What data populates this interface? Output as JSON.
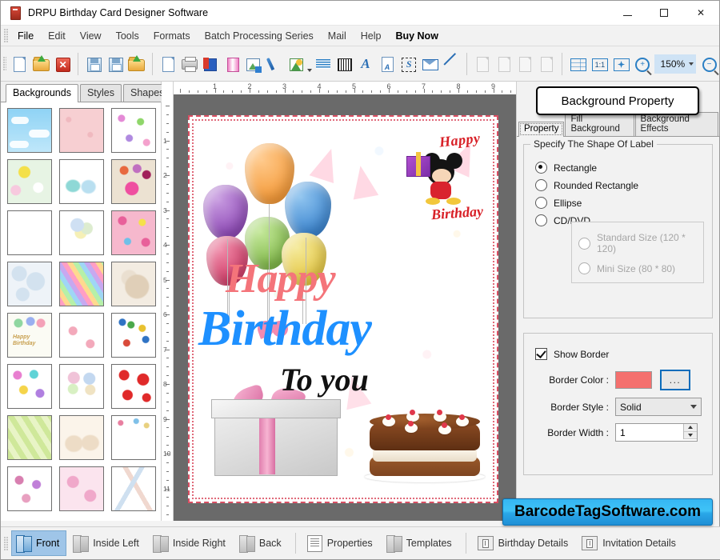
{
  "window": {
    "title": "DRPU Birthday Card Designer Software",
    "app_icon": "app-icon",
    "minimize": "—",
    "maximize": "□",
    "close": "✕"
  },
  "menubar": {
    "items": [
      {
        "label": "File",
        "emphasis": "strong"
      },
      {
        "label": "Edit",
        "emphasis": "normal"
      },
      {
        "label": "View",
        "emphasis": "normal"
      },
      {
        "label": "Tools",
        "emphasis": "normal"
      },
      {
        "label": "Formats",
        "emphasis": "normal"
      },
      {
        "label": "Batch Processing Series",
        "emphasis": "normal"
      },
      {
        "label": "Mail",
        "emphasis": "normal"
      },
      {
        "label": "Help",
        "emphasis": "normal"
      },
      {
        "label": "Buy Now",
        "emphasis": "bold"
      }
    ]
  },
  "toolbar": {
    "groups": [
      {
        "buttons": [
          {
            "icon": "new-document-icon",
            "title": "New"
          },
          {
            "icon": "open-folder-icon",
            "title": "Open"
          },
          {
            "icon": "close-document-icon",
            "title": "Close"
          }
        ]
      },
      {
        "buttons": [
          {
            "icon": "save-icon",
            "title": "Save"
          },
          {
            "icon": "save-as-icon",
            "title": "Save As"
          },
          {
            "icon": "export-folder-icon",
            "title": "Export"
          }
        ]
      },
      {
        "buttons": [
          {
            "icon": "page-setup-icon",
            "title": "Page Setup"
          },
          {
            "icon": "print-icon",
            "title": "Print"
          },
          {
            "icon": "card-stack-icon",
            "title": "Cards"
          },
          {
            "icon": "gift-icon",
            "title": "Gift"
          },
          {
            "icon": "add-image-icon",
            "title": "Add Image"
          },
          {
            "icon": "pen-icon",
            "title": "Pen"
          },
          {
            "icon": "picture-icon",
            "title": "Picture",
            "has_dropdown": true
          },
          {
            "icon": "watermark-icon",
            "title": "Watermark"
          },
          {
            "icon": "barcode-icon",
            "title": "Barcode"
          },
          {
            "icon": "text-italic-icon",
            "title": "Text"
          },
          {
            "icon": "text-page-icon",
            "title": "Text Page"
          },
          {
            "icon": "signature-icon",
            "title": "Signature"
          },
          {
            "icon": "envelope-icon",
            "title": "Envelope"
          },
          {
            "icon": "line-icon",
            "title": "Line"
          }
        ]
      },
      {
        "buttons": [
          {
            "icon": "cut-icon",
            "title": "Cut",
            "disabled": true
          },
          {
            "icon": "copy-icon",
            "title": "Copy",
            "disabled": true
          },
          {
            "icon": "paste-icon",
            "title": "Paste",
            "disabled": true
          },
          {
            "icon": "delete-icon",
            "title": "Delete",
            "disabled": true
          }
        ]
      },
      {
        "buttons": [
          {
            "icon": "grid-icon",
            "title": "Grid"
          },
          {
            "icon": "actual-size-icon",
            "title": "1:1"
          },
          {
            "icon": "fit-to-window-icon",
            "title": "Fit"
          },
          {
            "icon": "zoom-in-icon",
            "title": "Zoom In"
          }
        ]
      }
    ],
    "zoom_value": "150%",
    "zoom_out_icon": "zoom-out-icon",
    "one_to_one_label": "1:1"
  },
  "left_panel": {
    "tabs": [
      {
        "label": "Backgrounds",
        "active": true
      },
      {
        "label": "Styles",
        "active": false
      },
      {
        "label": "Shapes",
        "active": false
      }
    ],
    "thumbnails": [
      {
        "name": "clouds-sky"
      },
      {
        "name": "pink-texture"
      },
      {
        "name": "butterflies-flowers"
      },
      {
        "name": "yellow-daisies"
      },
      {
        "name": "pastel-winter-scene"
      },
      {
        "name": "beige-balloons"
      },
      {
        "name": "blue-stars"
      },
      {
        "name": "white-balloons"
      },
      {
        "name": "pink-cakes-balloons"
      },
      {
        "name": "white-bubbles"
      },
      {
        "name": "rainbow-gradient"
      },
      {
        "name": "cream-teddy"
      },
      {
        "name": "happy-birthday-balloons"
      },
      {
        "name": "pink-hearts-stripes"
      },
      {
        "name": "blue-sky-balloons"
      },
      {
        "name": "colorful-hearts"
      },
      {
        "name": "balloon-bouquets"
      },
      {
        "name": "red-hearts"
      },
      {
        "name": "green-stripes"
      },
      {
        "name": "cream-cakes"
      },
      {
        "name": "green-meadow-gifts"
      },
      {
        "name": "pink-lollipops"
      },
      {
        "name": "pink-swirl-hearts"
      },
      {
        "name": "party-hats"
      }
    ]
  },
  "rulers": {
    "horizontal_labels": [
      "1",
      "2",
      "3",
      "4",
      "5",
      "6",
      "7",
      "8",
      "9"
    ],
    "vertical_labels": [
      "1",
      "2",
      "3",
      "4",
      "5",
      "6",
      "7",
      "8",
      "9",
      "10",
      "11"
    ]
  },
  "card": {
    "line_happy": "Happy",
    "line_birthday": "Birthday",
    "line_to_you": "To you",
    "corner_happy": "Happy",
    "corner_birthday": "Birthday",
    "border_color": "#d94f63"
  },
  "right_panel": {
    "badge_title": "Background Property",
    "tabs": [
      {
        "label": "Property",
        "active": true
      },
      {
        "label": "Fill Background",
        "active": false
      },
      {
        "label": "Background Effects",
        "active": false
      }
    ],
    "shape_group": {
      "legend": "Specify The Shape Of Label",
      "options": [
        {
          "label": "Rectangle",
          "selected": true,
          "disabled": false
        },
        {
          "label": "Rounded Rectangle",
          "selected": false,
          "disabled": false
        },
        {
          "label": "Ellipse",
          "selected": false,
          "disabled": false
        },
        {
          "label": "CD/DVD",
          "selected": false,
          "disabled": false
        }
      ],
      "cd_sizes": [
        {
          "label": "Standard Size (120 * 120)",
          "selected": false,
          "disabled": true
        },
        {
          "label": "Mini Size (80 * 80)",
          "selected": false,
          "disabled": true
        }
      ]
    },
    "border_group": {
      "show_border_label": "Show Border",
      "show_border_checked": true,
      "border_color_label": "Border Color :",
      "border_color_value": "#f4706e",
      "browse_button_label": "...",
      "border_style_label": "Border Style :",
      "border_style_value": "Solid",
      "border_width_label": "Border Width :",
      "border_width_value": "1"
    }
  },
  "watermark": {
    "text": "BarcodeTagSoftware.com"
  },
  "bottom_bar": {
    "items": [
      {
        "label": "Front",
        "icon": "book-front-icon",
        "active": true
      },
      {
        "label": "Inside Left",
        "icon": "book-inside-left-icon",
        "active": false
      },
      {
        "label": "Inside Right",
        "icon": "book-inside-right-icon",
        "active": false
      },
      {
        "label": "Back",
        "icon": "book-back-icon",
        "active": false
      },
      {
        "label": "Properties",
        "icon": "properties-icon",
        "active": false
      },
      {
        "label": "Templates",
        "icon": "templates-icon",
        "active": false
      },
      {
        "label": "Birthday Details",
        "icon": "birthday-details-icon",
        "active": false
      },
      {
        "label": "Invitation Details",
        "icon": "invitation-details-icon",
        "active": false
      }
    ]
  }
}
